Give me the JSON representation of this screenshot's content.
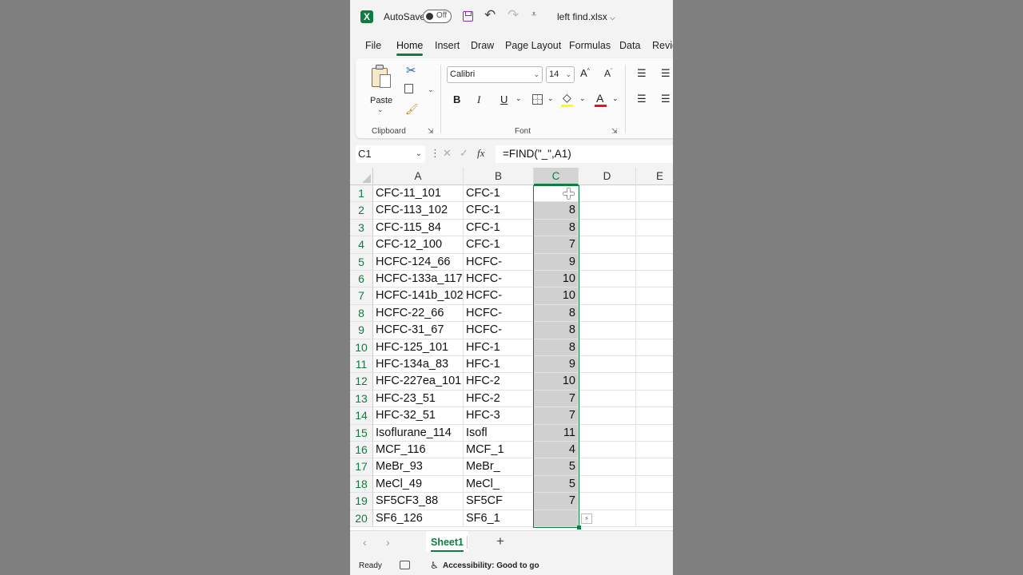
{
  "titlebar": {
    "app_logo": "X",
    "autosave_label": "AutoSave",
    "autosave_state": "Off",
    "filename": "left find.xlsx",
    "icons": [
      "excel-logo-icon",
      "save-icon",
      "undo-icon",
      "redo-icon",
      "customize-qat-icon"
    ]
  },
  "tabs": [
    "File",
    "Home",
    "Insert",
    "Draw",
    "Page Layout",
    "Formulas",
    "Data",
    "Revie"
  ],
  "active_tab": "Home",
  "ribbon": {
    "clipboard": {
      "paste_label": "Paste",
      "group_label": "Clipboard"
    },
    "font": {
      "font_name": "Calibri",
      "font_size": "14",
      "group_label": "Font",
      "bold": "B",
      "italic": "I",
      "underline": "U",
      "fill_color": "#ffff00",
      "font_color": "#e81123"
    }
  },
  "formula_bar": {
    "name_box": "C1",
    "fx": "fx",
    "formula": "=FIND(\"_\",A1)"
  },
  "columns": [
    "A",
    "B",
    "C",
    "D",
    "E"
  ],
  "selected_column": "C",
  "rows": [
    {
      "n": "1",
      "a": "CFC-11_101",
      "b": "CFC-1",
      "c": ""
    },
    {
      "n": "2",
      "a": "CFC-113_102",
      "b": "CFC-1",
      "c": "8"
    },
    {
      "n": "3",
      "a": "CFC-115_84",
      "b": "CFC-1",
      "c": "8"
    },
    {
      "n": "4",
      "a": "CFC-12_100",
      "b": "CFC-1",
      "c": "7"
    },
    {
      "n": "5",
      "a": "HCFC-124_66",
      "b": "HCFC-",
      "c": "9"
    },
    {
      "n": "6",
      "a": "HCFC-133a_117",
      "b": "HCFC-",
      "c": "10"
    },
    {
      "n": "7",
      "a": "HCFC-141b_102",
      "b": "HCFC-",
      "c": "10"
    },
    {
      "n": "8",
      "a": "HCFC-22_66",
      "b": "HCFC-",
      "c": "8"
    },
    {
      "n": "9",
      "a": "HCFC-31_67",
      "b": "HCFC-",
      "c": "8"
    },
    {
      "n": "10",
      "a": "HFC-125_101",
      "b": "HFC-1",
      "c": "8"
    },
    {
      "n": "11",
      "a": "HFC-134a_83",
      "b": "HFC-1",
      "c": "9"
    },
    {
      "n": "12",
      "a": "HFC-227ea_101",
      "b": "HFC-2",
      "c": "10"
    },
    {
      "n": "13",
      "a": "HFC-23_51",
      "b": "HFC-2",
      "c": "7"
    },
    {
      "n": "14",
      "a": "HFC-32_51",
      "b": "HFC-3",
      "c": "7"
    },
    {
      "n": "15",
      "a": "Isoflurane_114",
      "b": "Isofl",
      "c": "11"
    },
    {
      "n": "16",
      "a": "MCF_116",
      "b": "MCF_1",
      "c": "4"
    },
    {
      "n": "17",
      "a": "MeBr_93",
      "b": "MeBr_",
      "c": "5"
    },
    {
      "n": "18",
      "a": "MeCl_49",
      "b": "MeCl_",
      "c": "5"
    },
    {
      "n": "19",
      "a": "SF5CF3_88",
      "b": "SF5CF",
      "c": "7"
    },
    {
      "n": "20",
      "a": "SF6_126",
      "b": "SF6_1",
      "c": ""
    }
  ],
  "sheets": [
    "Sheet1"
  ],
  "status": {
    "ready": "Ready",
    "accessibility": "Accessibility: Good to go"
  },
  "colors": {
    "accent": "#107c41",
    "selection": "#d0d0d0"
  }
}
